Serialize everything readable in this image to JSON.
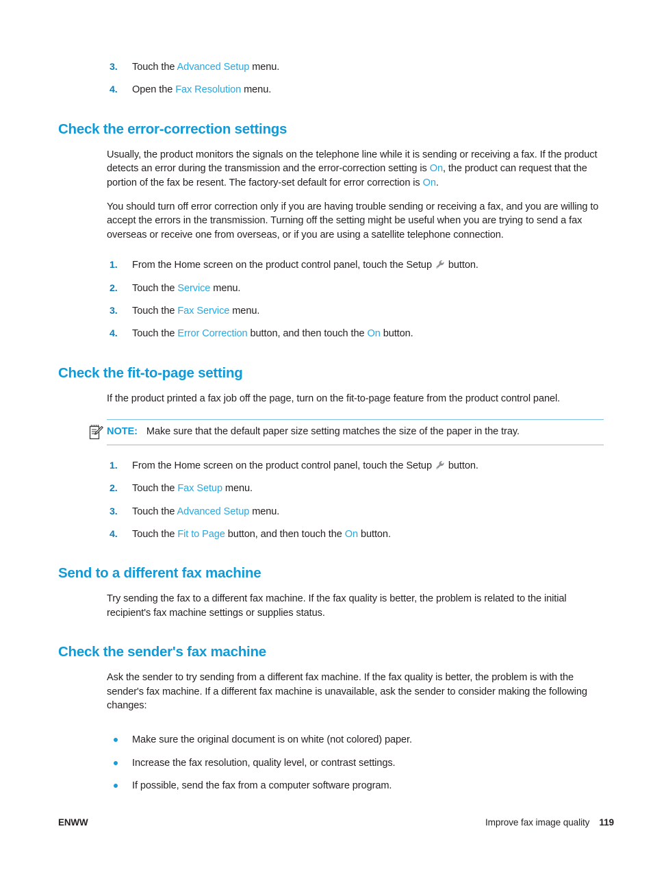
{
  "document": {
    "top_steps": [
      {
        "num": "3.",
        "pre": "Touch the ",
        "term": "Advanced Setup",
        "post": " menu."
      },
      {
        "num": "4.",
        "pre": "Open the ",
        "term": "Fax Resolution",
        "post": " menu."
      }
    ],
    "sections": [
      {
        "heading": "Check the error-correction settings",
        "paragraphs": [
          "Usually, the product monitors the signals on the telephone line while it is sending or receiving a fax. If the product detects an error during the transmission and the error-correction setting is ",
          "You should turn off error correction only if you are having trouble sending or receiving a fax, and you are willing to accept the errors in the transmission. Turning off the setting might be useful when you are trying to send a fax overseas or receive one from overseas, or if you are using a satellite telephone connection."
        ],
        "para1_term1": "On",
        "para1_mid": ", the product can request that the portion of the fax be resent. The factory-set default for error correction is ",
        "para1_term2": "On",
        "para1_end": ".",
        "steps": [
          {
            "num": "1.",
            "pre": "From the Home screen on the product control panel, touch the Setup ",
            "icon": "wrench-icon",
            "post": " button."
          },
          {
            "num": "2.",
            "pre": "Touch the ",
            "term": "Service",
            "post": " menu."
          },
          {
            "num": "3.",
            "pre": "Touch the ",
            "term": "Fax Service",
            "post": " menu."
          },
          {
            "num": "4.",
            "pre": "Touch the ",
            "term": "Error Correction",
            "mid": " button, and then touch the ",
            "term2": "On",
            "post": " button."
          }
        ]
      },
      {
        "heading": "Check the fit-to-page setting",
        "paragraph": "If the product printed a fax job off the page, turn on the fit-to-page feature from the product control panel.",
        "note": {
          "icon": "note-pencil-icon",
          "label": "NOTE:",
          "text": "Make sure that the default paper size setting matches the size of the paper in the tray."
        },
        "steps": [
          {
            "num": "1.",
            "pre": "From the Home screen on the product control panel, touch the Setup ",
            "icon": "wrench-icon",
            "post": " button."
          },
          {
            "num": "2.",
            "pre": "Touch the ",
            "term": "Fax Setup",
            "post": " menu."
          },
          {
            "num": "3.",
            "pre": "Touch the ",
            "term": "Advanced Setup",
            "post": " menu."
          },
          {
            "num": "4.",
            "pre": "Touch the ",
            "term": "Fit to Page",
            "mid": " button, and then touch the ",
            "term2": "On",
            "post": " button."
          }
        ]
      },
      {
        "heading": "Send to a different fax machine",
        "paragraph": "Try sending the fax to a different fax machine. If the fax quality is better, the problem is related to the initial recipient's fax machine settings or supplies status."
      },
      {
        "heading": "Check the sender's fax machine",
        "paragraph": "Ask the sender to try sending from a different fax machine. If the fax quality is better, the problem is with the sender's fax machine. If a different fax machine is unavailable, ask the sender to consider making the following changes:",
        "bullets": [
          "Make sure the original document is on white (not colored) paper.",
          "Increase the fax resolution, quality level, or contrast settings.",
          "If possible, send the fax from a computer software program."
        ]
      }
    ],
    "footer": {
      "left": "ENWW",
      "right_title": "Improve fax image quality",
      "page_number": "119"
    },
    "colors": {
      "heading_blue": "#0f9ad8",
      "link_blue": "#29a8e0",
      "number_blue": "#0c7dba",
      "bullet_blue": "#1b9bd8",
      "note_rule": "#7ec6e8",
      "text": "#231f20"
    }
  }
}
